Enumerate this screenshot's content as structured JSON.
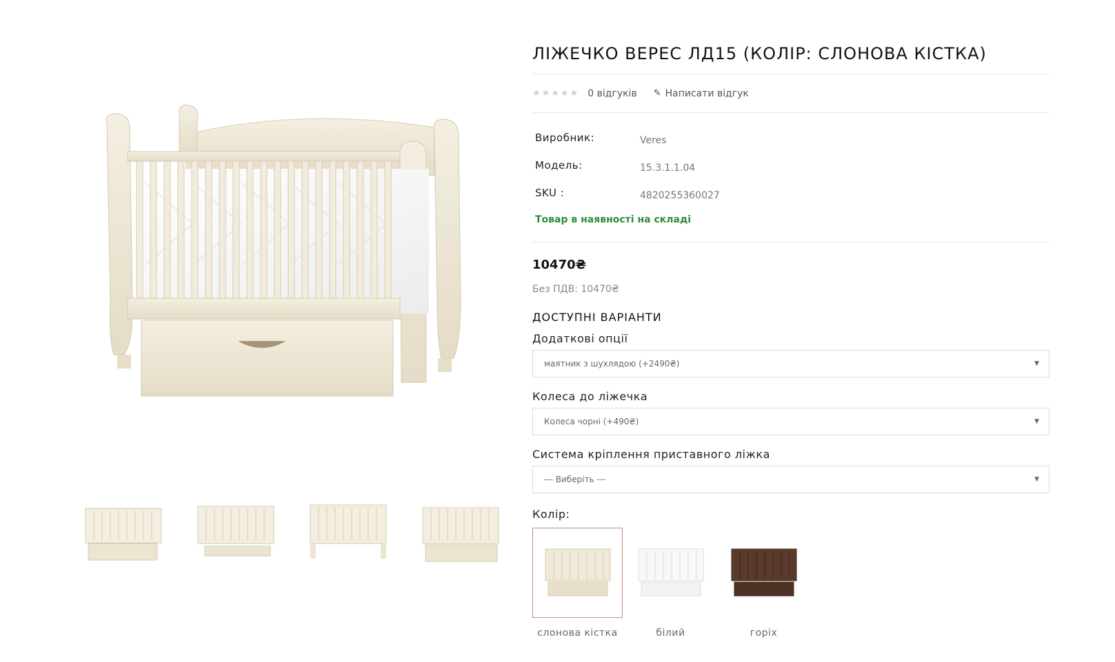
{
  "product": {
    "title": "ЛІЖЕЧКО ВЕРЕС ЛД15 (КОЛІР: СЛОНОВА КІСТКА)",
    "rating_stars": 0,
    "reviews_label": "0 відгуків",
    "write_review_label": "Написати відгук",
    "star_glyph": "★",
    "pencil_glyph": "✎"
  },
  "specs": [
    {
      "label": "Виробник:",
      "value": "Veres"
    },
    {
      "label": "Модель:",
      "value": "15.3.1.1.04"
    },
    {
      "label": "SKU :",
      "value": "4820255360027"
    }
  ],
  "stock_text": "Товар в наявності на складі",
  "price": "10470₴",
  "price_ex_vat": "Без ПДВ: 10470₴",
  "variants_title": "ДОСТУПНІ ВАРІАНТИ",
  "options": [
    {
      "label": "Додаткові опції",
      "selected": "маятник з шухлядою (+2490₴)"
    },
    {
      "label": "Колеса до ліжечка",
      "selected": "Колеса чорні (+490₴)"
    },
    {
      "label": "Система кріплення приставного ліжка",
      "selected": "--- Виберіть ---"
    }
  ],
  "chevron_glyph": "▼",
  "color_label": "Колір:",
  "colors": [
    {
      "name": "слонова кістка",
      "selected": true,
      "hex": "#efe9d8"
    },
    {
      "name": "білий",
      "selected": false,
      "hex": "#f7f7f5"
    },
    {
      "name": "горіх",
      "selected": false,
      "hex": "#5a3a2c"
    }
  ],
  "theme": {
    "ivory": "#efe9d8",
    "stock_green": "#2e8b3a",
    "selected_border": "#c48a7c"
  }
}
